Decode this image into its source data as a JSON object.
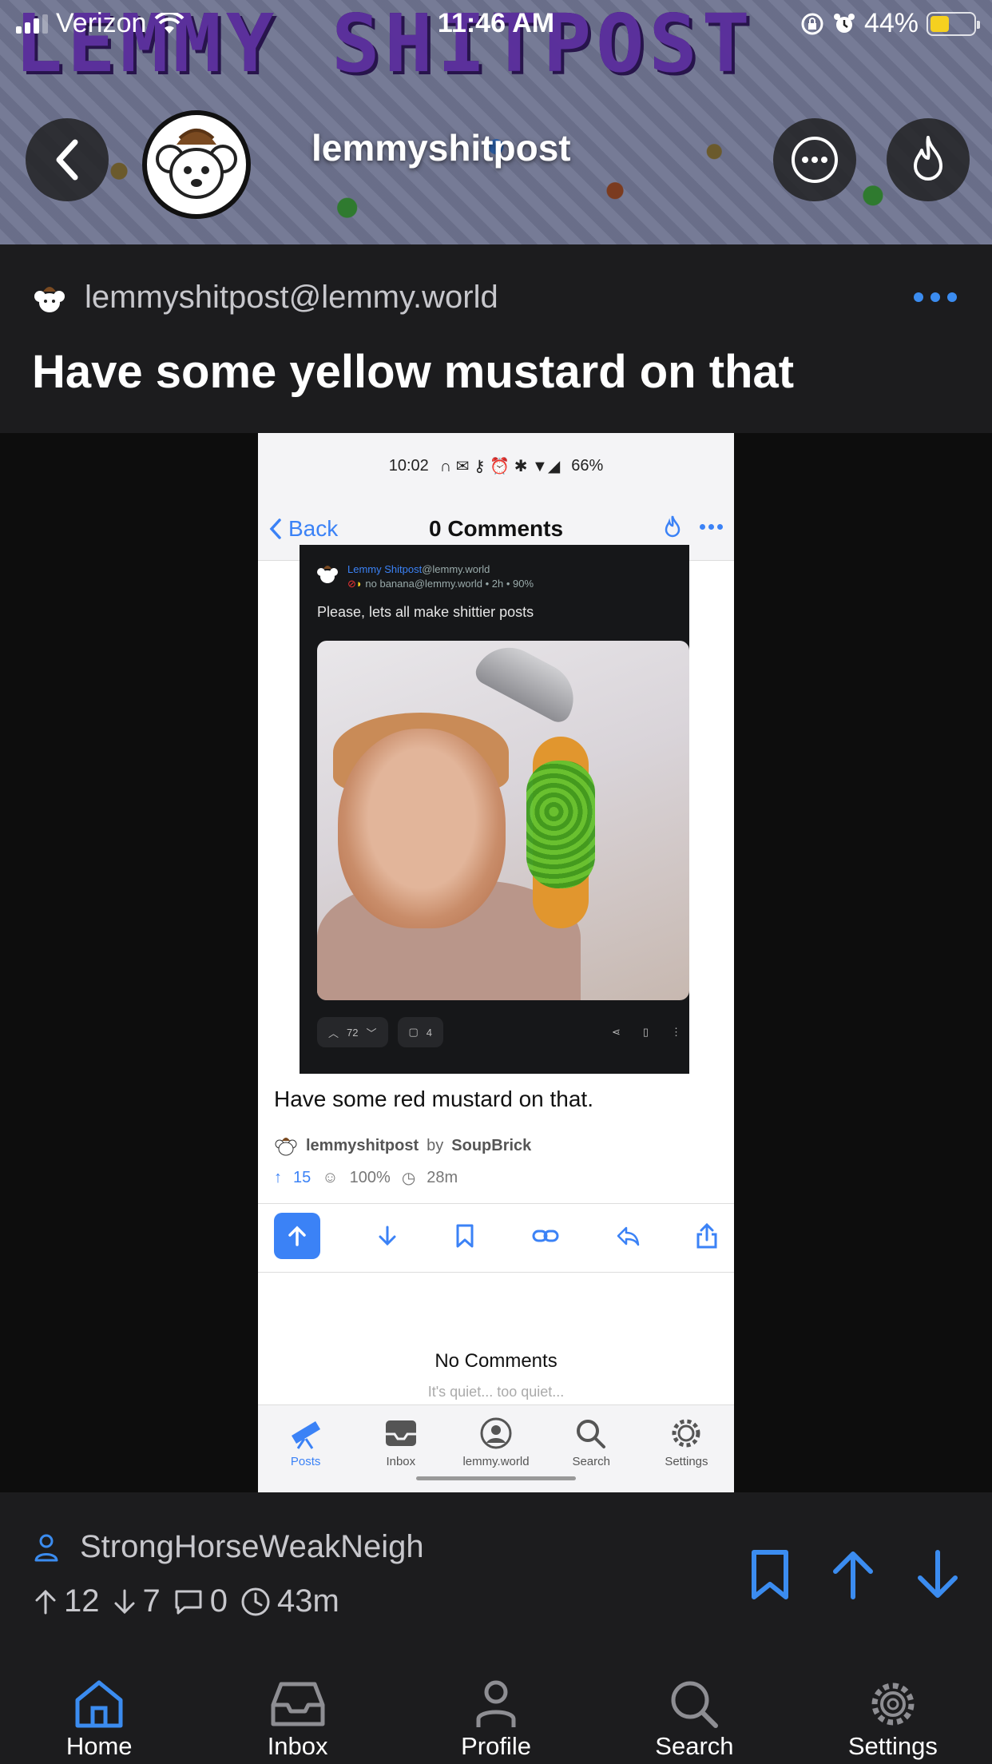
{
  "status_bar": {
    "carrier": "Verizon",
    "time": "11:46 AM",
    "battery": "44%",
    "battery_level": 0.44
  },
  "banner": {
    "text": "LEMMY SHITPOST",
    "community_name": "lemmyshitpost"
  },
  "post": {
    "community": "lemmyshitpost@lemmy.world",
    "title": "Have some yellow mustard on that",
    "author": "StrongHorseWeakNeigh",
    "upvotes": "12",
    "downvotes": "7",
    "comments": "0",
    "age": "43m"
  },
  "embedded": {
    "status_time": "10:02",
    "status_battery": "66%",
    "back_label": "Back",
    "nav_title": "0 Comments",
    "inner_community": "Lemmy Shitpost",
    "inner_instance": "@lemmy.world",
    "inner_user": "no banana",
    "inner_user_meta": "@lemmy.world • 2h • 90%",
    "inner_text": "Please, lets all make shittier posts",
    "inner_score": "72",
    "inner_comments": "4",
    "caption": "Have some red mustard on that.",
    "byline_community": "lemmyshitpost",
    "byline_by": "by",
    "byline_user": "SoupBrick",
    "score": "15",
    "ratio": "100%",
    "age": "28m",
    "no_comments": "No Comments",
    "quiet": "It's quiet... too quiet...",
    "tabs": [
      "Posts",
      "Inbox",
      "lemmy.world",
      "Search",
      "Settings"
    ]
  },
  "tabbar": {
    "home": "Home",
    "inbox": "Inbox",
    "profile": "Profile",
    "search": "Search",
    "settings": "Settings"
  },
  "colors": {
    "accent": "#3b8cf0",
    "background": "#1c1c1e",
    "banner_text": "#5a2d9c"
  }
}
